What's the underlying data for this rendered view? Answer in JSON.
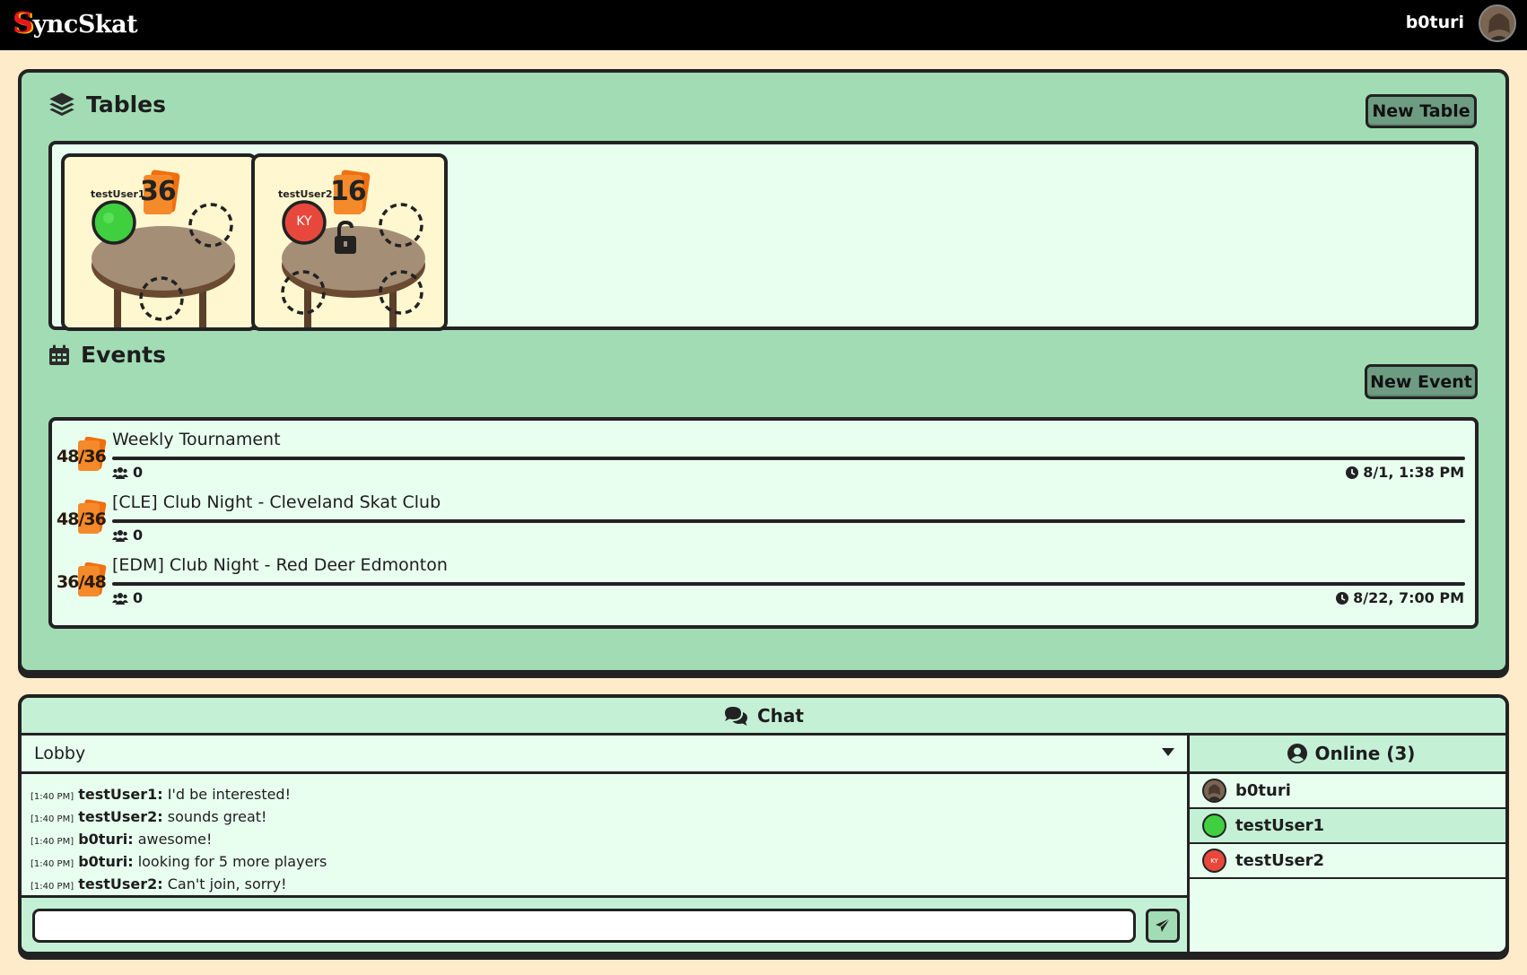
{
  "app": {
    "logo_initial": "S",
    "logo_rest": "yncSkat"
  },
  "user": {
    "name": "b0turi"
  },
  "tables_section": {
    "title": "Tables",
    "new_button": "New Table",
    "cards": [
      {
        "player": "testUser1",
        "count": "36",
        "avatar_color": "#3fcf3f",
        "locked": false
      },
      {
        "player": "testUser2",
        "count": "16",
        "avatar_color": "#e8483c",
        "avatar_initials": "KY",
        "locked": true
      }
    ]
  },
  "events_section": {
    "title": "Events",
    "new_button": "New Event",
    "events": [
      {
        "badge": "48/36",
        "title": "Weekly Tournament",
        "players": "0",
        "time": "8/1, 1:38 PM"
      },
      {
        "badge": "48/36",
        "title": "[CLE] Club Night - Cleveland Skat Club",
        "players": "0",
        "time": ""
      },
      {
        "badge": "36/48",
        "title": "[EDM] Club Night - Red Deer Edmonton",
        "players": "0",
        "time": "8/22, 7:00 PM"
      }
    ]
  },
  "chat": {
    "title": "Chat",
    "channel": "Lobby",
    "messages": [
      {
        "time": "[1:40 PM]",
        "author": "testUser1:",
        "text": " I'd be interested!"
      },
      {
        "time": "[1:40 PM]",
        "author": "testUser2:",
        "text": " sounds great!"
      },
      {
        "time": "[1:40 PM]",
        "author": "b0turi:",
        "text": " awesome!"
      },
      {
        "time": "[1:40 PM]",
        "author": "b0turi:",
        "text": " looking for 5 more players"
      },
      {
        "time": "[1:40 PM]",
        "author": "testUser2:",
        "text": " Can't join, sorry!"
      }
    ],
    "input_value": "",
    "online_title": "Online (3)",
    "online_users": [
      {
        "name": "b0turi",
        "avatar": "photo"
      },
      {
        "name": "testUser1",
        "avatar_color": "#3fcf3f"
      },
      {
        "name": "testUser2",
        "avatar_color": "#e8483c",
        "avatar_initials": "KY"
      }
    ]
  },
  "colors": {
    "topbar": "#000000",
    "page": "#fdebca",
    "panel": "#a2dcb4",
    "box": "#e8fff0",
    "button": "#6e9c82",
    "card_orange": "#f07010"
  },
  "icons": [
    "layers-icon",
    "calendar-icon",
    "users-icon",
    "clock-icon",
    "comments-icon",
    "user-circle-icon",
    "paper-plane-icon",
    "unlock-icon",
    "caret-down-icon"
  ]
}
